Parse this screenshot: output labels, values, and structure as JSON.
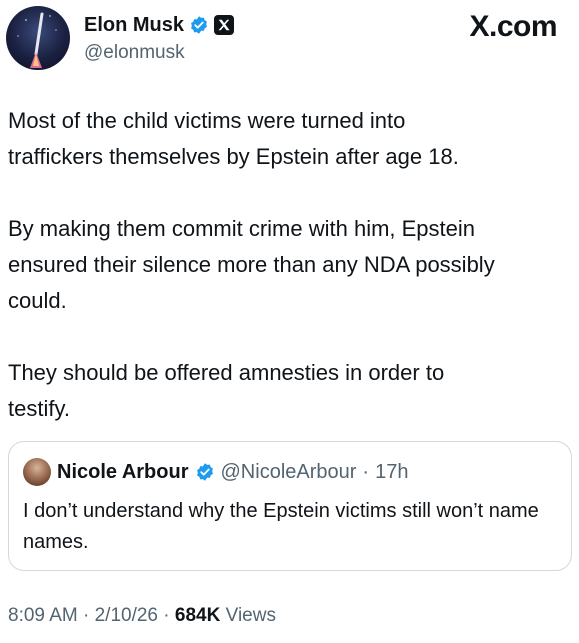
{
  "header": {
    "display_name": "Elon Musk",
    "handle": "@elonmusk",
    "site_label": "X.com",
    "verified_badge_icon": "verified-badge-icon",
    "affiliation_badge_icon": "x-logo-icon",
    "accent_color": "#1d9bf0"
  },
  "tweet": {
    "paragraphs": [
      "Most of the child victims were turned into\ntraffickers themselves by Epstein after age 18.",
      "By making them commit crime with him, Epstein\nensured their silence more than any NDA possibly\ncould.",
      "They should be offered amnesties in order to\ntestify."
    ]
  },
  "quote": {
    "display_name": "Nicole Arbour",
    "handle": "@NicoleArbour",
    "separator": " · ",
    "time_ago": "17h",
    "text": "I don’t understand why the Epstein victims still won’t name names."
  },
  "footer": {
    "time": "8:09 AM",
    "separator": " · ",
    "date": "2/10/26",
    "views_count": "684K",
    "views_label": "Views"
  }
}
